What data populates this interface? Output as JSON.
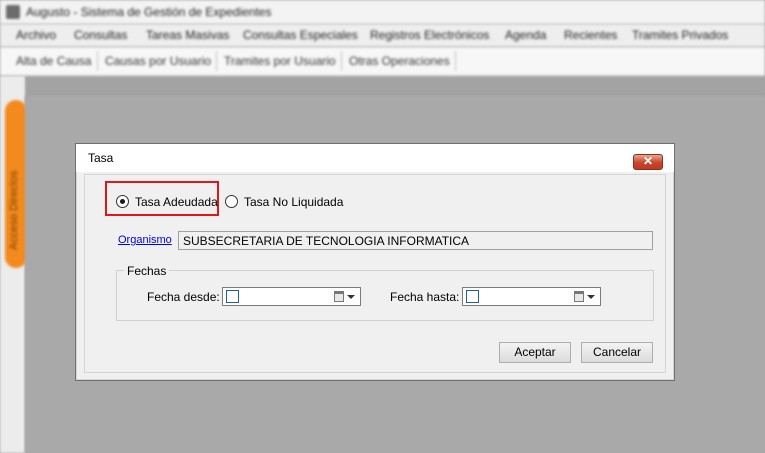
{
  "app": {
    "title": "Augusto - Sistema de Gestión de Expedientes",
    "menu": [
      "Archivo",
      "Consultas",
      "Tareas Masivas",
      "Consultas Especiales",
      "Registros Electrónicos",
      "Agenda",
      "Recientes",
      "Tramites Privados"
    ],
    "toolbar": [
      "Alta de Causa",
      "Causas por Usuario",
      "Tramites por Usuario",
      "Otras Operaciones"
    ],
    "side_tab": "Acceso Directos"
  },
  "dialog": {
    "title": "Tasa",
    "close_glyph": "✕",
    "radio_adeudada": "Tasa Adeudada",
    "radio_no_liquidada": "Tasa No Liquidada",
    "organismo_link": "Organismo",
    "organismo_value": "SUBSECRETARIA DE TECNOLOGIA INFORMATICA",
    "fechas_legend": "Fechas",
    "fecha_desde_label": "Fecha desde:",
    "fecha_desde_value": "",
    "fecha_hasta_label": "Fecha hasta:",
    "fecha_hasta_value": "",
    "accept_label": "Aceptar",
    "cancel_label": "Cancelar"
  },
  "colors": {
    "highlight": "#e0161d",
    "side_tab": "#f28a1e",
    "close_button": "#c7452b",
    "link": "#0000ee"
  }
}
